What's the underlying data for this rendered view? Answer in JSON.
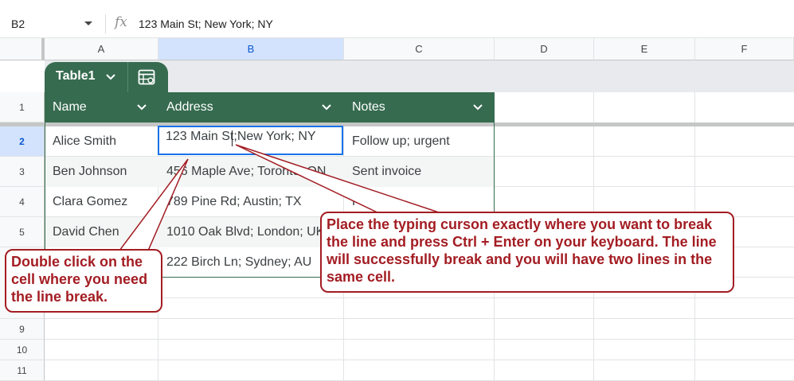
{
  "formula_bar": {
    "cell_reference": "B2",
    "fx_label": "fx",
    "formula_value": "123 Main St; New York; NY"
  },
  "columns": [
    "A",
    "B",
    "C",
    "D",
    "E",
    "F"
  ],
  "selected_column": "B",
  "rows": [
    "1",
    "2",
    "3",
    "4",
    "5",
    "9",
    "10",
    "11"
  ],
  "selected_row": "2",
  "table": {
    "name": "Table1",
    "headers": [
      "Name",
      "Address",
      "Notes"
    ],
    "header_color": "#366b4f",
    "rows": [
      {
        "name": "Alice Smith",
        "address": "123 Main St; New York; NY",
        "notes": "Follow up; urgent"
      },
      {
        "name": "Ben Johnson",
        "address": "456 Maple Ave; Toronto; ON",
        "notes": "Sent invoice"
      },
      {
        "name": "Clara Gomez",
        "address": "789 Pine Rd; Austin; TX",
        "notes": "Fi"
      },
      {
        "name": "David Chen",
        "address": "1010 Oak Blvd; London; UK",
        "notes": ""
      },
      {
        "name": "",
        "address": "222 Birch Ln; Sydney; AU",
        "notes": ""
      }
    ]
  },
  "active_cell": {
    "ref": "B2",
    "text_before_cursor": "123 Main St;",
    "text_after_cursor": "New York; NY"
  },
  "callouts": {
    "left": "Double click on the cell where you need the line break.",
    "right": "Place the typing curson exactly where you want to break the line and press Ctrl + Enter on your keyboard. The line will successfully break and you will have two lines in the same cell.",
    "color": "#a31d23"
  },
  "icons": {
    "name_box_dropdown": "chevron-down-icon",
    "table_menu": "chevron-down-icon",
    "table_settings": "table-settings-icon"
  }
}
